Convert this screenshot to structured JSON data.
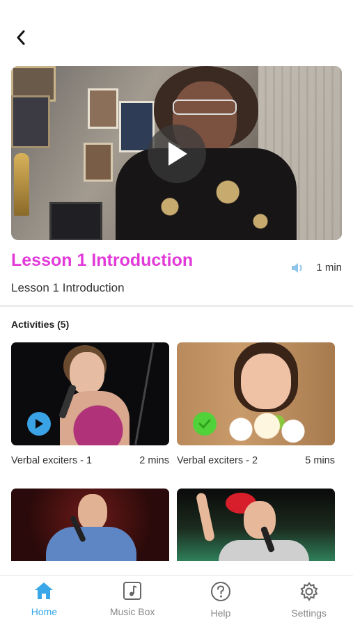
{
  "lesson": {
    "title": "Lesson 1 Introduction",
    "subtitle": "Lesson 1 Introduction",
    "duration": "1 min"
  },
  "activities": {
    "heading": "Activities (5)",
    "items": [
      {
        "label": "Verbal exciters - 1",
        "duration": "2 mins",
        "status": "play"
      },
      {
        "label": "Verbal exciters - 2",
        "duration": "5 mins",
        "status": "completed"
      },
      {
        "label": "",
        "duration": "",
        "status": "completed"
      },
      {
        "label": "",
        "duration": "",
        "status": "completed"
      }
    ]
  },
  "tabs": [
    {
      "label": "Home",
      "icon": "home-icon",
      "active": true
    },
    {
      "label": "Music Box",
      "icon": "music-note-icon",
      "active": false
    },
    {
      "label": "Help",
      "icon": "help-icon",
      "active": false
    },
    {
      "label": "Settings",
      "icon": "gear-icon",
      "active": false
    }
  ],
  "colors": {
    "accent_title": "#e23ad9",
    "tab_active": "#39a7e8",
    "play_badge": "#3aa3e6",
    "completed_badge": "#52d23a"
  }
}
